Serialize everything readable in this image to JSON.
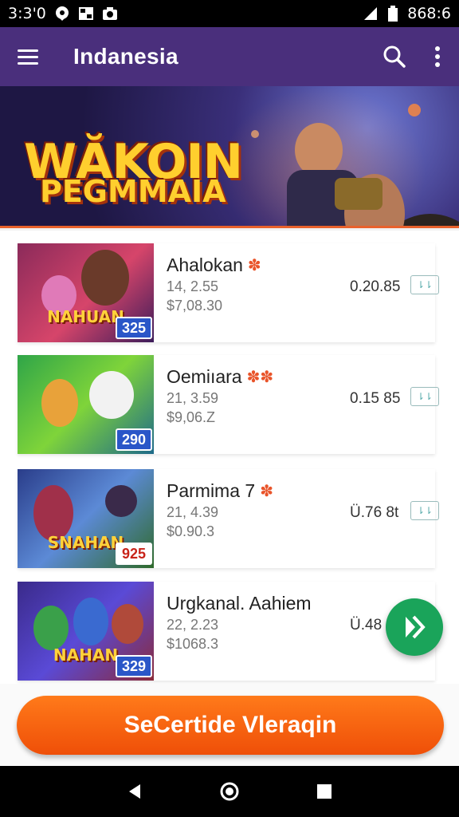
{
  "status_bar": {
    "time": "3:3'0",
    "battery_text": "868:6",
    "icons": [
      "notification-icon",
      "gallery-icon",
      "camera-icon",
      "signal-icon",
      "battery-icon"
    ]
  },
  "app_bar": {
    "title": "Indanesia",
    "icons": [
      "menu-icon",
      "search-icon",
      "more-vert-icon"
    ]
  },
  "banner": {
    "line1": "WĂKOIN",
    "line2": "PEGMMAIA"
  },
  "games": [
    {
      "title": "Ahalokan",
      "line1": "14, 2.55",
      "line2": "$7,08.30",
      "price": "0.20.85",
      "thumb_text": "NAHUAN",
      "badge": "325",
      "badge_style": "blue",
      "stars": 1,
      "theme": [
        "#8b2a5a",
        "#d6456a",
        "#3b1c5a"
      ]
    },
    {
      "title": "Oemiıara",
      "line1": "21, 3.59",
      "line2": "$9,06.Z",
      "price": "0.15 85",
      "thumb_text": "",
      "badge": "290",
      "badge_style": "blue",
      "stars": 2,
      "theme": [
        "#2fa548",
        "#7fd43a",
        "#1e6a8a"
      ]
    },
    {
      "title": "Parmima 7",
      "line1": "21, 4.39",
      "line2": "$0.90.3",
      "price": "Ü.76 8t",
      "thumb_text": "SNAHAN",
      "badge": "925",
      "badge_style": "white",
      "stars": 1,
      "theme": [
        "#2a3d8a",
        "#5c8ad6",
        "#2f6a2a"
      ]
    },
    {
      "title": "Urgkanal. Aahiem",
      "line1": "22, 2.23",
      "line2": "$1068.3",
      "price": "Ü.48",
      "thumb_text": "NAHAN",
      "badge": "329",
      "badge_style": "blue",
      "stars": 0,
      "theme": [
        "#3a2a8a",
        "#5a4ad6",
        "#8a2a3a"
      ]
    }
  ],
  "fab": {
    "icon": "play-icon"
  },
  "cta": {
    "label": "SeCertide Vleraqin"
  },
  "nav_bar": {
    "icons": [
      "back-icon",
      "home-icon",
      "recents-icon"
    ]
  }
}
